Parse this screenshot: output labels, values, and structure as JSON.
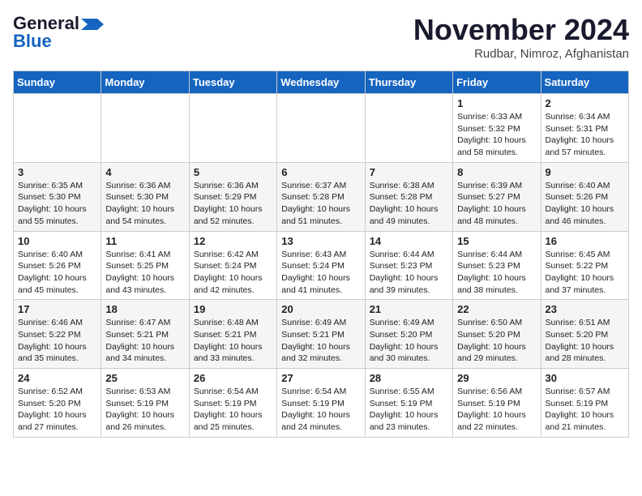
{
  "logo": {
    "line1": "General",
    "line2": "Blue"
  },
  "header": {
    "month": "November 2024",
    "location": "Rudbar, Nimroz, Afghanistan"
  },
  "weekdays": [
    "Sunday",
    "Monday",
    "Tuesday",
    "Wednesday",
    "Thursday",
    "Friday",
    "Saturday"
  ],
  "weeks": [
    [
      {
        "day": "",
        "info": ""
      },
      {
        "day": "",
        "info": ""
      },
      {
        "day": "",
        "info": ""
      },
      {
        "day": "",
        "info": ""
      },
      {
        "day": "",
        "info": ""
      },
      {
        "day": "1",
        "info": "Sunrise: 6:33 AM\nSunset: 5:32 PM\nDaylight: 10 hours and 58 minutes."
      },
      {
        "day": "2",
        "info": "Sunrise: 6:34 AM\nSunset: 5:31 PM\nDaylight: 10 hours and 57 minutes."
      }
    ],
    [
      {
        "day": "3",
        "info": "Sunrise: 6:35 AM\nSunset: 5:30 PM\nDaylight: 10 hours and 55 minutes."
      },
      {
        "day": "4",
        "info": "Sunrise: 6:36 AM\nSunset: 5:30 PM\nDaylight: 10 hours and 54 minutes."
      },
      {
        "day": "5",
        "info": "Sunrise: 6:36 AM\nSunset: 5:29 PM\nDaylight: 10 hours and 52 minutes."
      },
      {
        "day": "6",
        "info": "Sunrise: 6:37 AM\nSunset: 5:28 PM\nDaylight: 10 hours and 51 minutes."
      },
      {
        "day": "7",
        "info": "Sunrise: 6:38 AM\nSunset: 5:28 PM\nDaylight: 10 hours and 49 minutes."
      },
      {
        "day": "8",
        "info": "Sunrise: 6:39 AM\nSunset: 5:27 PM\nDaylight: 10 hours and 48 minutes."
      },
      {
        "day": "9",
        "info": "Sunrise: 6:40 AM\nSunset: 5:26 PM\nDaylight: 10 hours and 46 minutes."
      }
    ],
    [
      {
        "day": "10",
        "info": "Sunrise: 6:40 AM\nSunset: 5:26 PM\nDaylight: 10 hours and 45 minutes."
      },
      {
        "day": "11",
        "info": "Sunrise: 6:41 AM\nSunset: 5:25 PM\nDaylight: 10 hours and 43 minutes."
      },
      {
        "day": "12",
        "info": "Sunrise: 6:42 AM\nSunset: 5:24 PM\nDaylight: 10 hours and 42 minutes."
      },
      {
        "day": "13",
        "info": "Sunrise: 6:43 AM\nSunset: 5:24 PM\nDaylight: 10 hours and 41 minutes."
      },
      {
        "day": "14",
        "info": "Sunrise: 6:44 AM\nSunset: 5:23 PM\nDaylight: 10 hours and 39 minutes."
      },
      {
        "day": "15",
        "info": "Sunrise: 6:44 AM\nSunset: 5:23 PM\nDaylight: 10 hours and 38 minutes."
      },
      {
        "day": "16",
        "info": "Sunrise: 6:45 AM\nSunset: 5:22 PM\nDaylight: 10 hours and 37 minutes."
      }
    ],
    [
      {
        "day": "17",
        "info": "Sunrise: 6:46 AM\nSunset: 5:22 PM\nDaylight: 10 hours and 35 minutes."
      },
      {
        "day": "18",
        "info": "Sunrise: 6:47 AM\nSunset: 5:21 PM\nDaylight: 10 hours and 34 minutes."
      },
      {
        "day": "19",
        "info": "Sunrise: 6:48 AM\nSunset: 5:21 PM\nDaylight: 10 hours and 33 minutes."
      },
      {
        "day": "20",
        "info": "Sunrise: 6:49 AM\nSunset: 5:21 PM\nDaylight: 10 hours and 32 minutes."
      },
      {
        "day": "21",
        "info": "Sunrise: 6:49 AM\nSunset: 5:20 PM\nDaylight: 10 hours and 30 minutes."
      },
      {
        "day": "22",
        "info": "Sunrise: 6:50 AM\nSunset: 5:20 PM\nDaylight: 10 hours and 29 minutes."
      },
      {
        "day": "23",
        "info": "Sunrise: 6:51 AM\nSunset: 5:20 PM\nDaylight: 10 hours and 28 minutes."
      }
    ],
    [
      {
        "day": "24",
        "info": "Sunrise: 6:52 AM\nSunset: 5:20 PM\nDaylight: 10 hours and 27 minutes."
      },
      {
        "day": "25",
        "info": "Sunrise: 6:53 AM\nSunset: 5:19 PM\nDaylight: 10 hours and 26 minutes."
      },
      {
        "day": "26",
        "info": "Sunrise: 6:54 AM\nSunset: 5:19 PM\nDaylight: 10 hours and 25 minutes."
      },
      {
        "day": "27",
        "info": "Sunrise: 6:54 AM\nSunset: 5:19 PM\nDaylight: 10 hours and 24 minutes."
      },
      {
        "day": "28",
        "info": "Sunrise: 6:55 AM\nSunset: 5:19 PM\nDaylight: 10 hours and 23 minutes."
      },
      {
        "day": "29",
        "info": "Sunrise: 6:56 AM\nSunset: 5:19 PM\nDaylight: 10 hours and 22 minutes."
      },
      {
        "day": "30",
        "info": "Sunrise: 6:57 AM\nSunset: 5:19 PM\nDaylight: 10 hours and 21 minutes."
      }
    ]
  ]
}
